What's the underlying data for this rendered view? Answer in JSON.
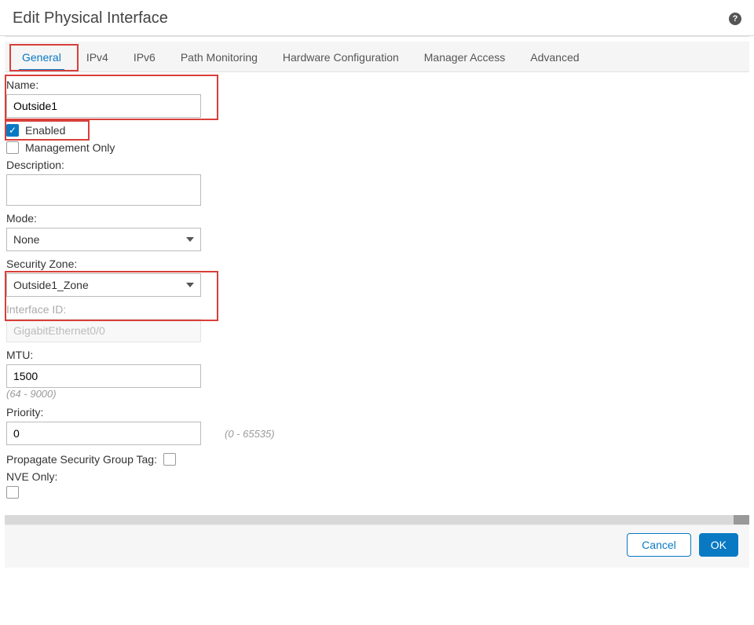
{
  "header": {
    "title": "Edit Physical Interface",
    "help_icon": "?"
  },
  "tabs": {
    "items": [
      {
        "label": "General",
        "active": true
      },
      {
        "label": "IPv4"
      },
      {
        "label": "IPv6"
      },
      {
        "label": "Path Monitoring"
      },
      {
        "label": "Hardware Configuration"
      },
      {
        "label": "Manager Access"
      },
      {
        "label": "Advanced"
      }
    ]
  },
  "form": {
    "name_label": "Name:",
    "name_value": "Outside1",
    "enabled_label": "Enabled",
    "enabled_checked": true,
    "mgmt_only_label": "Management Only",
    "mgmt_only_checked": false,
    "description_label": "Description:",
    "description_value": "",
    "mode_label": "Mode:",
    "mode_value": "None",
    "security_zone_label": "Security Zone:",
    "security_zone_value": "Outside1_Zone",
    "interface_id_label": "Interface ID:",
    "interface_id_value": "GigabitEthernet0/0",
    "mtu_label": "MTU:",
    "mtu_value": "1500",
    "mtu_hint": "(64 - 9000)",
    "priority_label": "Priority:",
    "priority_value": "0",
    "priority_hint": "(0 - 65535)",
    "psgt_label": "Propagate Security Group Tag:",
    "psgt_checked": false,
    "nve_label": "NVE Only:",
    "nve_checked": false
  },
  "footer": {
    "cancel": "Cancel",
    "ok": "OK"
  }
}
